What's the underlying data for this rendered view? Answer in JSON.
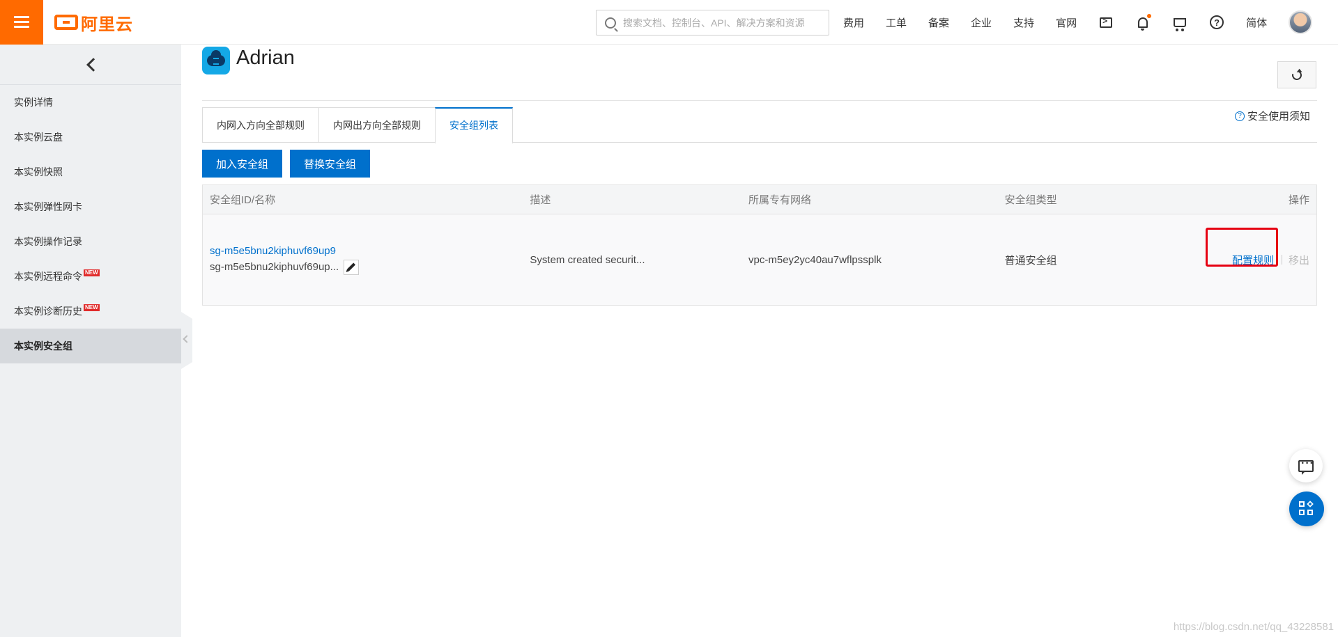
{
  "header": {
    "logo_text": "阿里云",
    "search_placeholder": "搜索文档、控制台、API、解决方案和资源",
    "nav": [
      "费用",
      "工单",
      "备案",
      "企业",
      "支持",
      "官网"
    ],
    "language": "简体",
    "icons": [
      "menu-icon",
      "terminal-icon",
      "bell-icon",
      "cart-icon",
      "help-icon"
    ]
  },
  "sidebar": {
    "items": [
      {
        "label": "实例详情"
      },
      {
        "label": "本实例云盘"
      },
      {
        "label": "本实例快照"
      },
      {
        "label": "本实例弹性网卡"
      },
      {
        "label": "本实例操作记录"
      },
      {
        "label": "本实例远程命令",
        "badge": "NEW"
      },
      {
        "label": "本实例诊断历史",
        "badge": "NEW"
      },
      {
        "label": "本实例安全组",
        "active": true
      }
    ]
  },
  "page": {
    "instance_name": "Adrian",
    "notice": "安全使用须知",
    "tabs": [
      "内网入方向全部规则",
      "内网出方向全部规则",
      "安全组列表"
    ],
    "active_tab": "安全组列表",
    "buttons": {
      "join": "加入安全组",
      "replace": "替换安全组"
    }
  },
  "table": {
    "headers": [
      "安全组ID/名称",
      "描述",
      "所属专有网络",
      "安全组类型",
      "操作"
    ],
    "rows": [
      {
        "id": "sg-m5e5bnu2kiphuvf69up9",
        "name": "sg-m5e5bnu2kiphuvf69up...",
        "description": "System created securit...",
        "vpc": "vpc-m5ey2yc40au7wflpssplk",
        "type": "普通安全组",
        "actions": {
          "config": "配置规则",
          "remove": "移出"
        }
      }
    ]
  },
  "watermark": "https://blog.csdn.net/qq_43228581",
  "colors": {
    "brand": "#ff6a00",
    "primary": "#0070cc",
    "highlight": "#e60012"
  }
}
